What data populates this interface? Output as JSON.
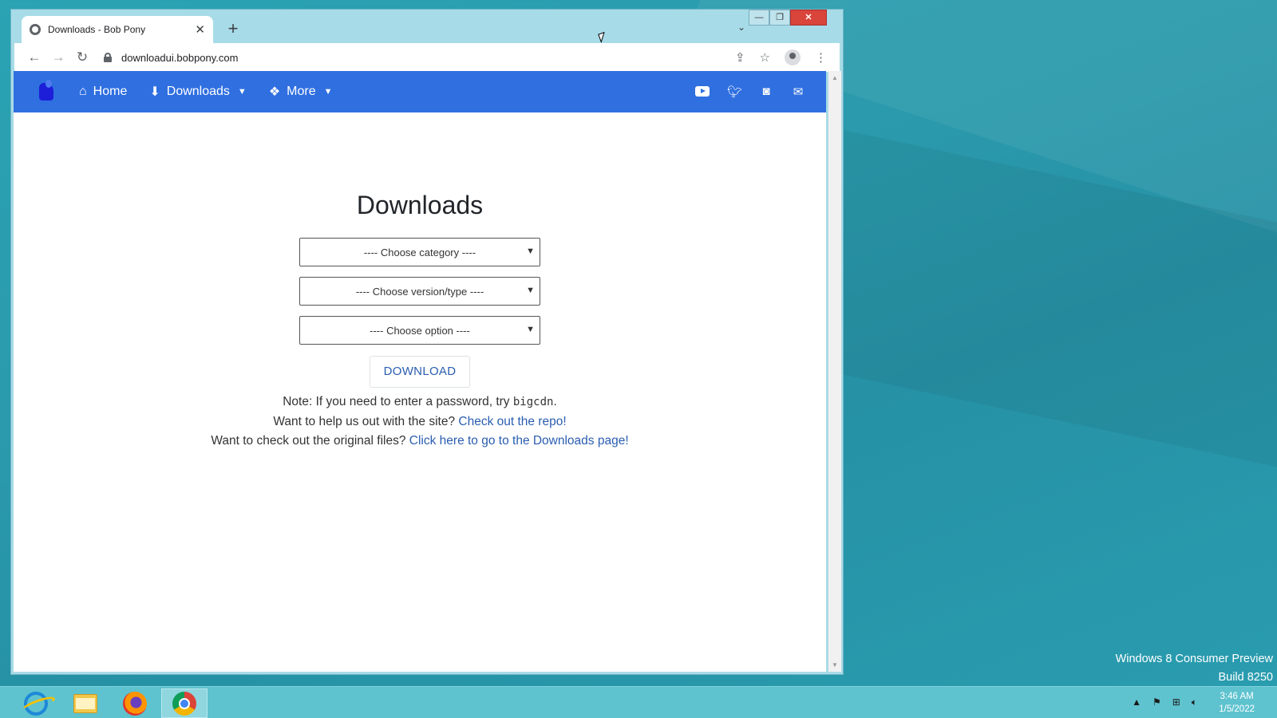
{
  "browser": {
    "tab_title": "Downloads - Bob Pony",
    "tab_close": "✕",
    "new_tab": "+",
    "url": "downloadui.bobpony.com",
    "controls": {
      "minimize": "—",
      "maximize": "❐",
      "close": "✕"
    }
  },
  "site": {
    "nav": {
      "home": "Home",
      "downloads": "Downloads",
      "more": "More"
    },
    "heading": "Downloads",
    "selects": {
      "category": "---- Choose category ----",
      "version": "---- Choose version/type ----",
      "option": "---- Choose option ----"
    },
    "download_button": "DOWNLOAD",
    "note_prefix": "Note: If you need to enter a password, try",
    "note_code": "bigcdn",
    "note_suffix": ".",
    "help_prefix": "Want to help us out with the site?",
    "help_link": "Check out the repo!",
    "orig_prefix": "Want to check out the original files?",
    "orig_link": "Click here to go to the Downloads page!"
  },
  "desktop": {
    "watermark_line1": "Windows 8 Consumer Preview",
    "watermark_line2": "Build 8250",
    "clock_time": "3:46 AM",
    "clock_date": "1/5/2022"
  },
  "colors": {
    "navbar": "#2f6fe0",
    "link": "#2a5db0"
  }
}
